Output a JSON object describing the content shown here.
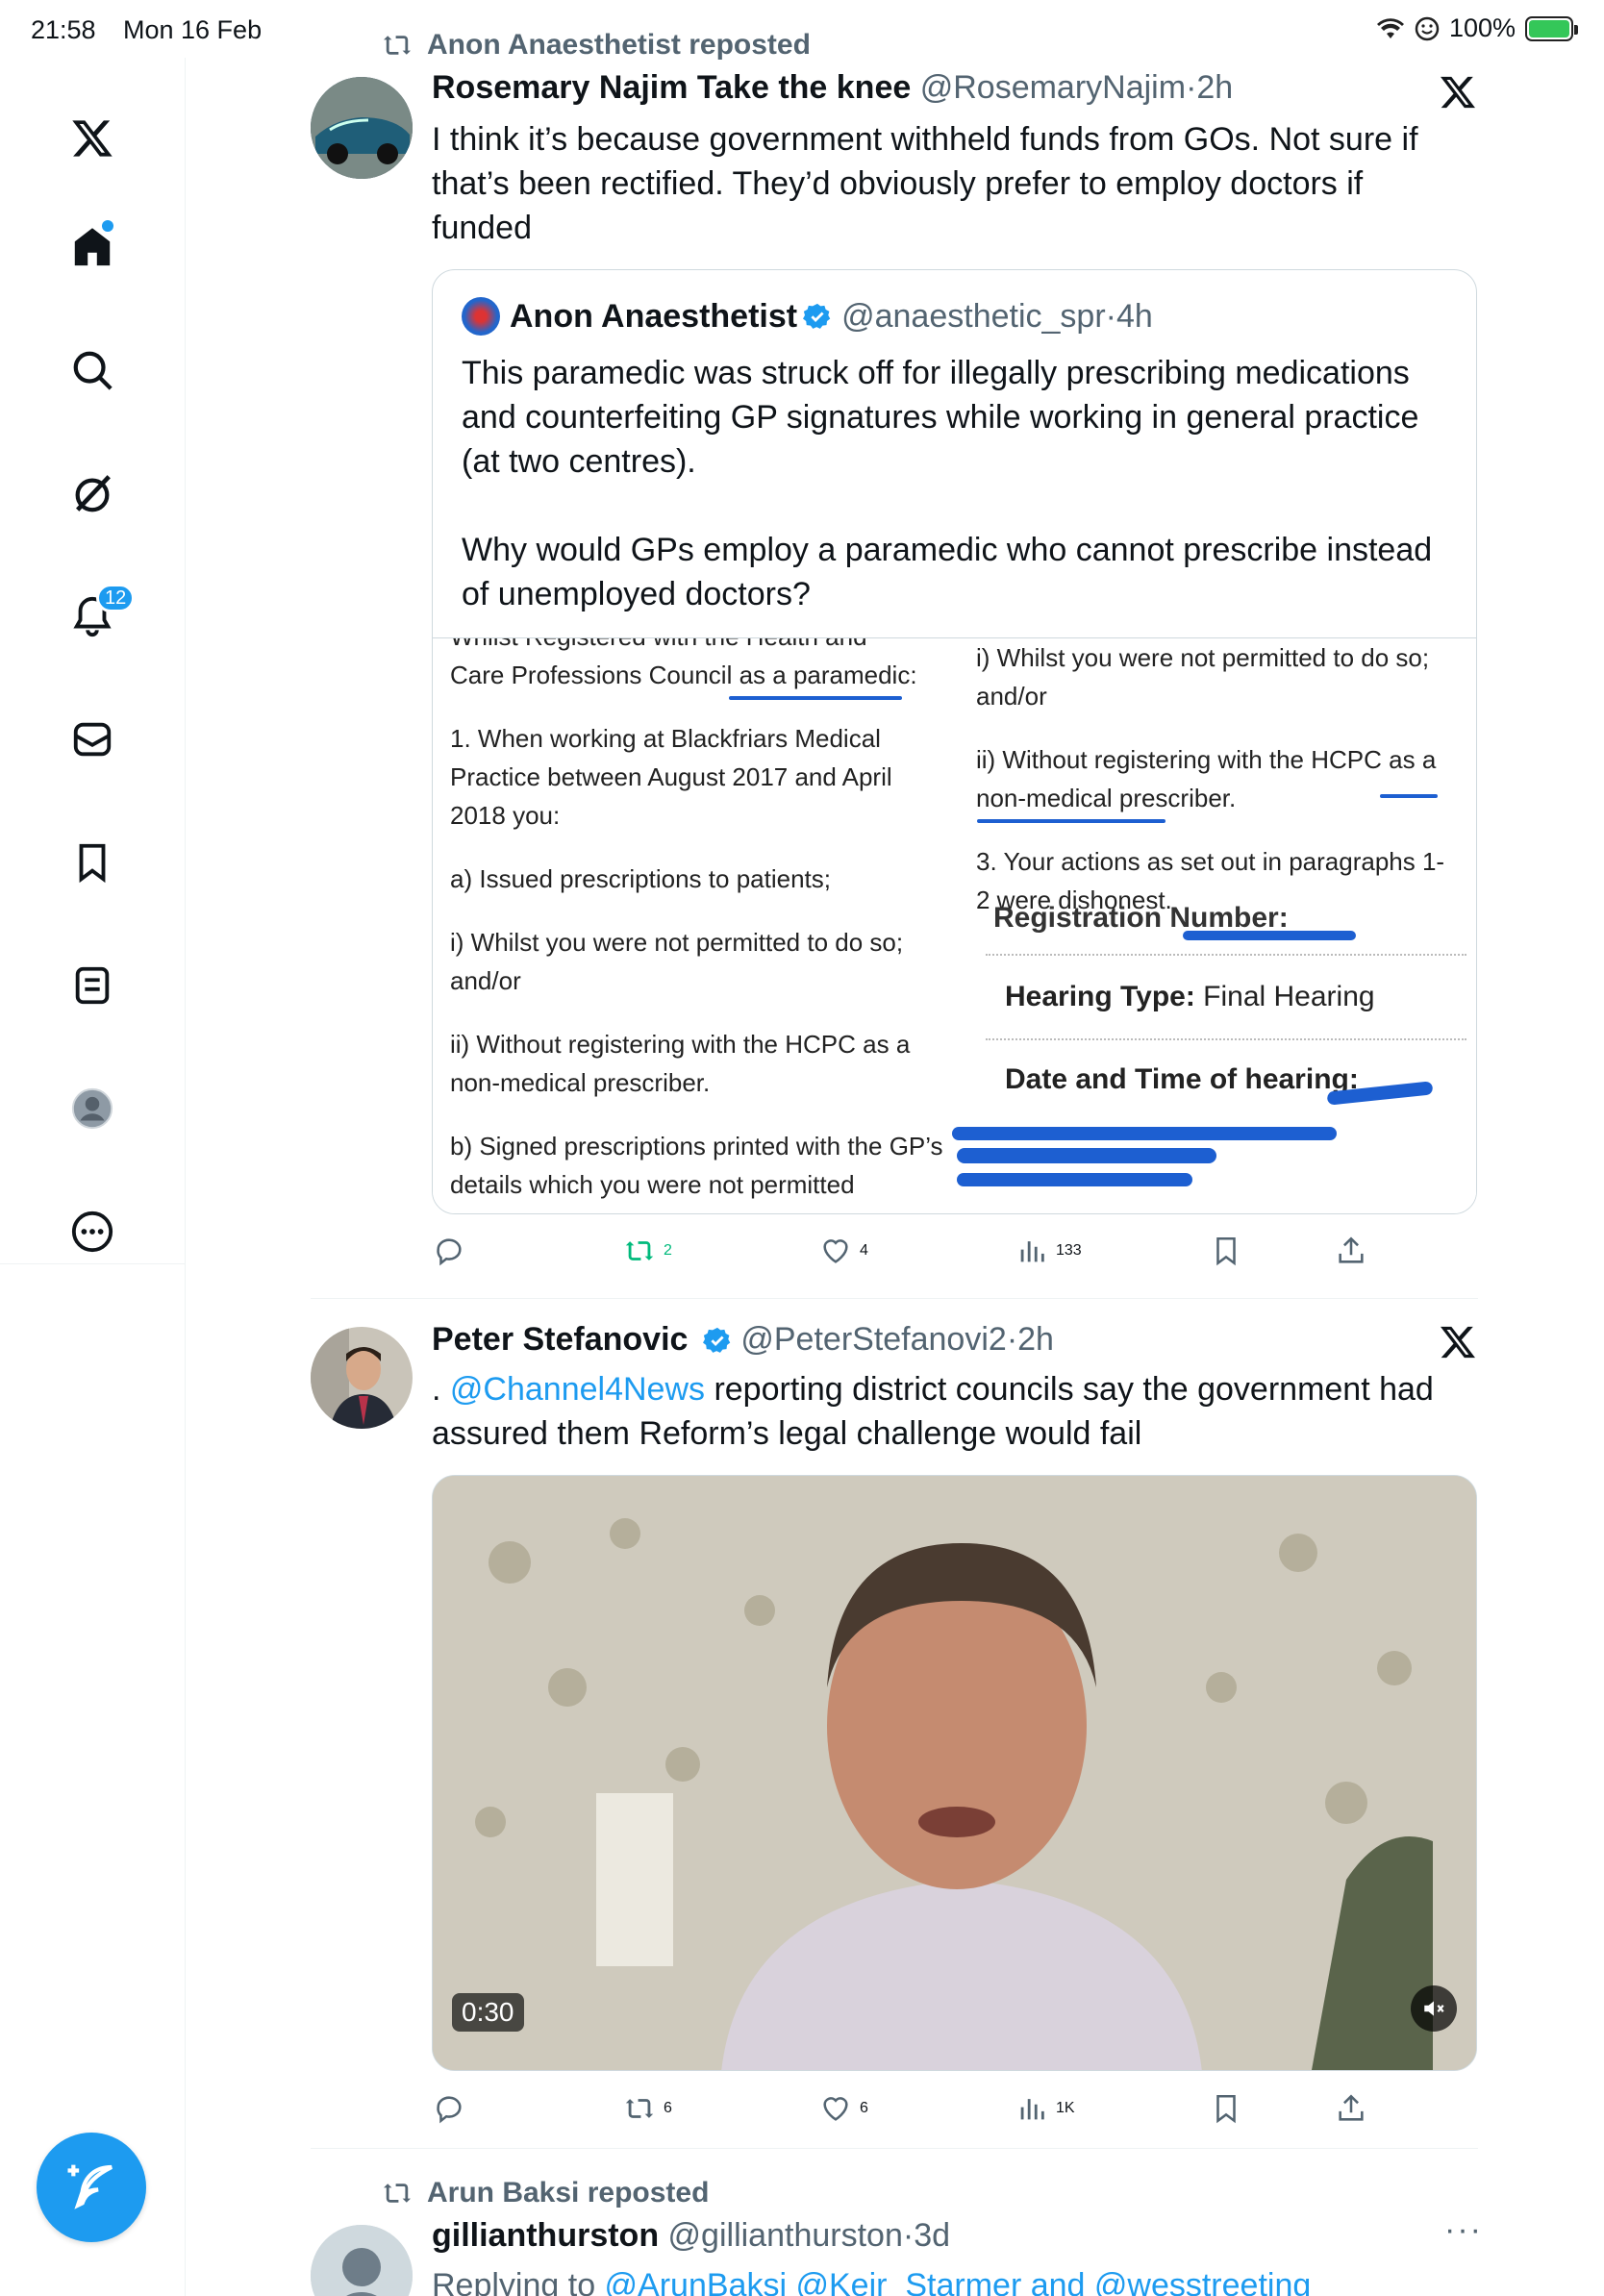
{
  "status_bar": {
    "time": "21:58",
    "date": "Mon 16 Feb",
    "battery": "100%"
  },
  "sidebar": {
    "notifications_count": "12"
  },
  "tweets": [
    {
      "repost_by": "Anon Anaesthetist reposted",
      "name": "Rosemary Najim Take the knee",
      "handle": "@RosemaryNajim",
      "sep": "·",
      "time": "2h",
      "text": "I think it’s because government withheld funds from GOs. Not sure if that’s been rectified.  They’d obviously prefer to employ doctors if funded",
      "quote": {
        "name": "Anon Anaesthetist",
        "handle": "@anaesthetic_spr",
        "sep": "·",
        "time": "4h",
        "text_p1": "This paramedic was struck off for illegally prescribing medications and counterfeiting GP signatures while working in general practice (at two centres).",
        "text_p2": "Why would GPs employ a paramedic who cannot prescribe instead of unemployed doctors?",
        "doc": {
          "left_top_cut": "Whilst Registered with the Health and",
          "left_l1": "Care Professions Council as a paramedic:",
          "left_p2": "1. When working at Blackfriars Medical Practice between August 2017 and April 2018 you:",
          "left_p3": "a) Issued prescriptions to patients;",
          "left_p4": "i) Whilst you were not permitted to do so; and/or",
          "left_p5": "ii) Without registering with the HCPC as a non-medical prescriber.",
          "left_p6": "b) Signed prescriptions printed with the GP’s details which you were not permitted",
          "right_p1": "i) Whilst you were not permitted to do so; and/or",
          "right_p2": "ii) Without registering with the HCPC as a non-medical prescriber.",
          "right_p3": "3. Your actions as set out in paragraphs 1-2 were dishonest.",
          "right_cut": "Registration Number:",
          "hearing_type_label": "Hearing Type:",
          "hearing_type_value": "Final Hearing",
          "date_label": "Date and Time of hearing:"
        }
      },
      "stats": {
        "reposts": "2",
        "likes": "4",
        "views": "133"
      }
    },
    {
      "name": "Peter Stefanovic",
      "handle": "@PeterStefanovi2",
      "sep": "·",
      "time": "2h",
      "text_prefix": ". ",
      "mention": "@Channel4News",
      "text": " reporting district councils say the government had assured them Reform’s legal challenge would fail",
      "video_duration": "0:30",
      "stats": {
        "reposts": "6",
        "likes": "6",
        "views": "1K"
      }
    },
    {
      "repost_by": "Arun Baksi reposted",
      "name": "gillianthurston",
      "handle": "@gillianthurston",
      "sep": "·",
      "time": "3d",
      "reply_prefix": "Replying to ",
      "reply_to": "@ArunBaksi @Keir_Starmer and @wesstreeting"
    }
  ],
  "colors": {
    "accent": "#1d9bf0",
    "repost_green": "#00ba7c",
    "secondary_text": "#536471"
  }
}
